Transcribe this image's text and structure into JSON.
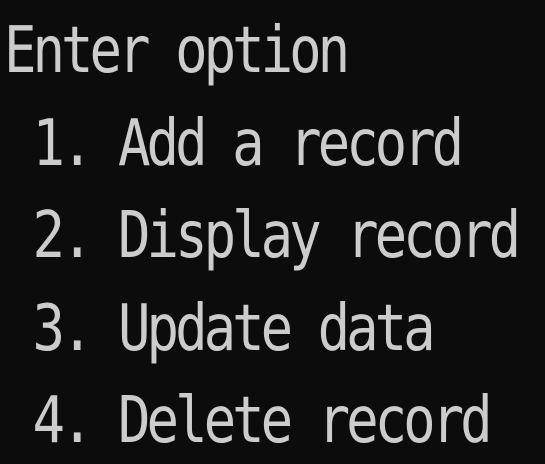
{
  "console": {
    "text_color": "#cccccc",
    "background_color": "#0c0c0c",
    "lines": [
      "Enter option",
      " 1. Add a record",
      " 2. Display record",
      " 3. Update data",
      " 4. Delete record"
    ]
  }
}
